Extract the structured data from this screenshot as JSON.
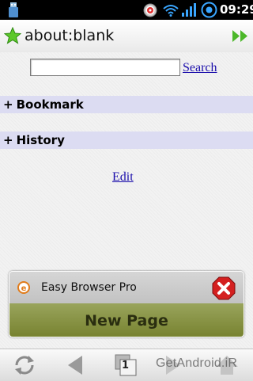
{
  "status_bar": {
    "time": "09:29",
    "icons": [
      "usb-storage-icon",
      "alarm-icon",
      "wifi-icon",
      "signal-icon",
      "sync-icon"
    ]
  },
  "address_bar": {
    "url": "about:blank",
    "icons": [
      "bookmark-star-icon",
      "go-forward-icon"
    ]
  },
  "search": {
    "input_value": "",
    "button_label": "Search"
  },
  "sections": {
    "bookmark": {
      "toggle": "+",
      "label": "Bookmark"
    },
    "history": {
      "toggle": "+",
      "label": "History"
    }
  },
  "edit_link": "Edit",
  "tab_card": {
    "title": "Easy Browser Pro",
    "new_page_label": "New Page",
    "icons": [
      "favicon-icon",
      "close-icon"
    ]
  },
  "toolbar": {
    "tab_count": "1",
    "icons": [
      "refresh-icon",
      "back-icon",
      "tabs-icon",
      "forward-icon",
      "menu-icon"
    ]
  },
  "watermark": "GetAndroid.iR",
  "colors": {
    "section_bg": "#dcdcf2",
    "link": "#1a0dab",
    "new_page_bg": "#8a9545",
    "close_red": "#d42020",
    "star_green": "#5cc82a"
  }
}
